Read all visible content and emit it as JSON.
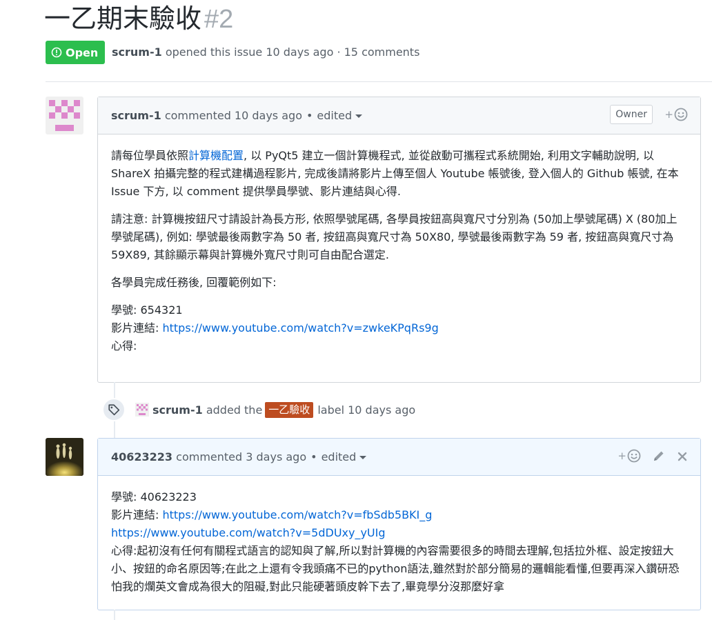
{
  "issue": {
    "title": "一乙期末驗收",
    "number": "#2",
    "state": "Open",
    "author": "scrum-1",
    "meta_text": "opened this issue 10 days ago · 15 comments"
  },
  "comment1": {
    "author": "scrum-1",
    "action": "commented 10 days ago",
    "edited": "edited",
    "badge": "Owner",
    "para1_pre": "請每位學員依照",
    "para1_link": "計算機配置",
    "para1_post": ", 以 PyQt5 建立一個計算機程式, 並從啟動可攜程式系統開始, 利用文字輔助說明, 以 ShareX 拍攝完整的程式建構過程影片, 完成後請將影片上傳至個人 Youtube 帳號後, 登入個人的 Github 帳號, 在本 Issue 下方, 以 comment 提供學員學號、影片連結與心得.",
    "para2": "請注意: 計算機按鈕尺寸請設計為長方形, 依照學號尾碼, 各學員按鈕高與寬尺寸分別為 (50加上學號尾碼) X (80加上學號尾碼), 例如: 學號最後兩數字為 50 者, 按鈕高與寬尺寸為 50X80, 學號最後兩數字為 59 者, 按鈕高與寬尺寸為 59X89, 其餘顯示幕與計算機外寬尺寸則可自由配合選定.",
    "para3": "各學員完成任務後, 回覆範例如下:",
    "line_id": "學號: 654321",
    "line_video_label": "影片連結: ",
    "line_video_url": "https://www.youtube.com/watch?v=zwkeKPqRs9g",
    "line_note": "心得:"
  },
  "event": {
    "actor": "scrum-1",
    "pre": "added the",
    "label": "一乙驗收",
    "post": "label 10 days ago",
    "label_color": "#bd4c20"
  },
  "comment2": {
    "author": "40623223",
    "action": "commented 3 days ago",
    "edited": "edited",
    "line_id": "學號: 40623223",
    "line_video_label": "影片連結: ",
    "url1": "https://www.youtube.com/watch?v=fbSdb5BKI_g",
    "url2": "https://www.youtube.com/watch?v=5dDUxy_yUIg",
    "note": "心得:起初沒有任何有關程式語言的認知與了解,所以對計算機的內容需要很多的時間去理解,包括拉外框、設定按鈕大小、按鈕的命名原因等;在此之上還有令我頭痛不已的python語法,雖然對於部分簡易的邏輯能看懂,但要再深入鑽研恐怕我的爛英文會成為很大的阻礙,對此只能硬著頭皮幹下去了,畢竟學分沒那麼好拿"
  },
  "colors": {
    "open_green": "#2cbe4e",
    "link_blue": "#0366d6",
    "identicon_pink": "#dd88cc"
  },
  "icons": [
    "issue-opened-icon",
    "smiley-icon",
    "tag-icon",
    "pencil-icon",
    "close-icon",
    "caret-down-icon"
  ]
}
